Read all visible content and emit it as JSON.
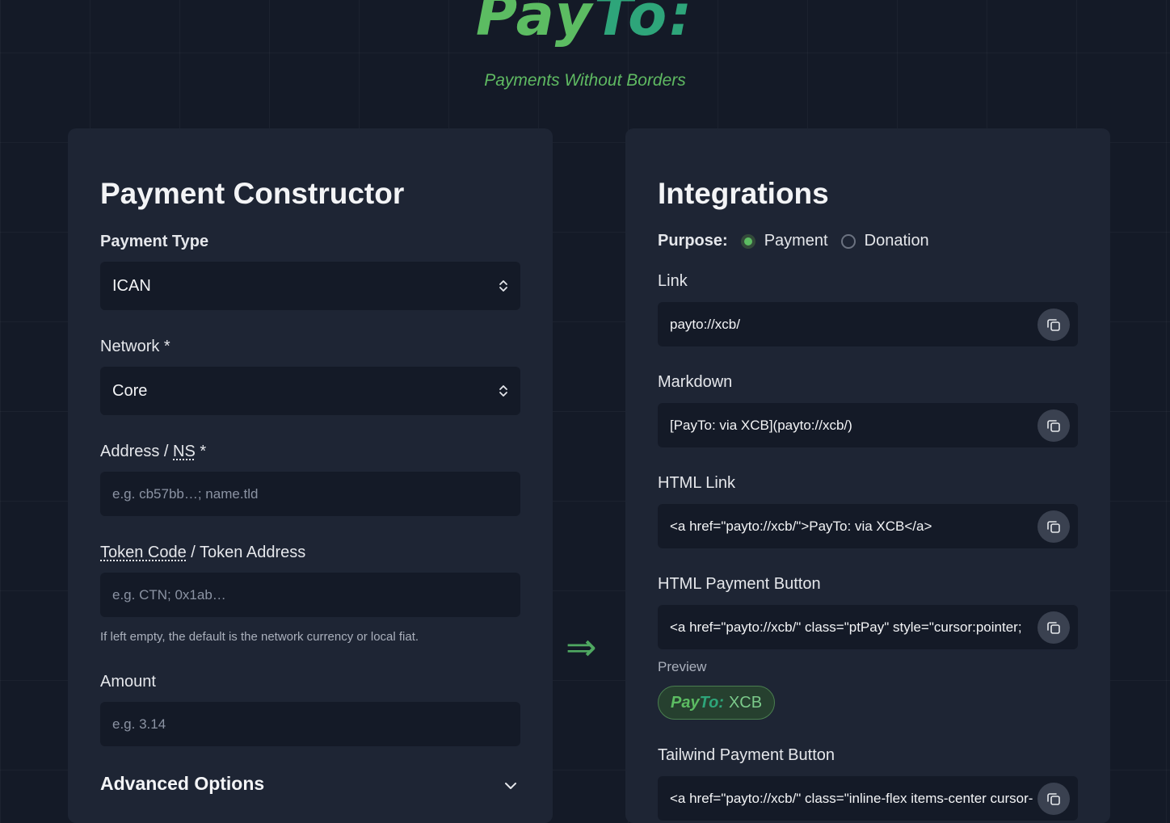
{
  "header": {
    "logo_pay": "Pay",
    "logo_to": "To:",
    "tagline": "Payments Without Borders"
  },
  "constructor": {
    "title": "Payment Constructor",
    "payment_type": {
      "label": "Payment Type",
      "value": "ICAN"
    },
    "network": {
      "label": "Network *",
      "value": "Core"
    },
    "address": {
      "label_a": "Address / ",
      "label_b": "NS",
      "label_c": " *",
      "placeholder": "e.g. cb57bb…; name.tld"
    },
    "token": {
      "label_a": "Token Code",
      "label_b": " / Token Address",
      "placeholder": "e.g. CTN; 0x1ab…",
      "hint": "If left empty, the default is the network currency or local fiat."
    },
    "amount": {
      "label": "Amount",
      "placeholder": "e.g. 3.14"
    },
    "advanced": {
      "label": "Advanced Options",
      "icon": "chevron-down-icon"
    }
  },
  "arrow": "⇒",
  "integrations": {
    "title": "Integrations",
    "purpose": {
      "label": "Purpose:",
      "options": [
        "Payment",
        "Donation"
      ],
      "selected": "Payment"
    },
    "link": {
      "label": "Link",
      "value": "payto://xcb/"
    },
    "markdown": {
      "label": "Markdown",
      "value": "[PayTo: via XCB](payto://xcb/)"
    },
    "html_link": {
      "label": "HTML Link",
      "value": "<a href=\"payto://xcb/\">PayTo: via XCB</a>"
    },
    "html_button": {
      "label": "HTML Payment Button",
      "value": "<a href=\"payto://xcb/\" class=\"ptPay\" style=\"cursor:pointer;"
    },
    "preview": {
      "label": "Preview",
      "pay": "Pay",
      "to": "To:",
      "network": "XCB"
    },
    "tailwind_button": {
      "label": "Tailwind Payment Button",
      "value": "<a href=\"payto://xcb/\" class=\"inline-flex items-center cursor-"
    }
  },
  "colors": {
    "background": "#141a27",
    "panel": "#1e2534",
    "accent_green": "#5cbc62",
    "accent_teal": "#2ea57a"
  }
}
